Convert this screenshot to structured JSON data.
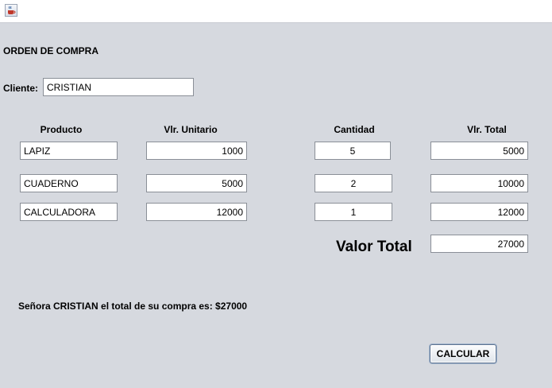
{
  "window": {
    "icon": "java-cup-icon"
  },
  "form": {
    "title": "ORDEN DE COMPRA",
    "cliente_label": "Cliente:",
    "cliente_value": "CRISTIAN",
    "headers": {
      "producto": "Producto",
      "unitario": "Vlr. Unitario",
      "cantidad": "Cantidad",
      "total": "Vlr. Total"
    },
    "rows": [
      {
        "producto": "LAPIZ",
        "unitario": "1000",
        "cantidad": "5",
        "total": "5000"
      },
      {
        "producto": "CUADERNO",
        "unitario": "5000",
        "cantidad": "2",
        "total": "10000"
      },
      {
        "producto": "CALCULADORA",
        "unitario": "12000",
        "cantidad": "1",
        "total": "12000"
      }
    ],
    "valor_total_label": "Valor Total",
    "valor_total_value": "27000",
    "message": "Señora CRISTIAN el total de su compra es: $27000",
    "calcular_label": "CALCULAR"
  }
}
